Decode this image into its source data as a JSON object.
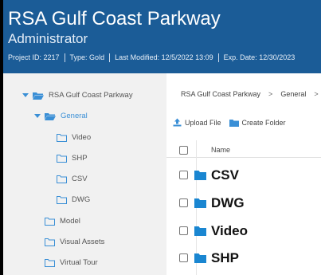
{
  "header": {
    "title": "RSA Gulf Coast Parkway",
    "role": "Administrator",
    "meta": {
      "project_id": "Project ID: 2217",
      "type": "Type: Gold",
      "last_modified": "Last Modified: 12/5/2022 13:09",
      "exp_date": "Exp. Date: 12/30/2023"
    }
  },
  "sidebar": {
    "root": "RSA Gulf Coast Parkway",
    "general": "General",
    "general_children": [
      "Video",
      "SHP",
      "CSV",
      "DWG"
    ],
    "others": [
      "Model",
      "Visual Assets",
      "Virtual Tour"
    ]
  },
  "main": {
    "breadcrumb": [
      "RSA Gulf Coast Parkway",
      "General"
    ],
    "toolbar": {
      "upload": "Upload File",
      "create_folder": "Create Folder"
    },
    "table": {
      "name_header": "Name",
      "rows": [
        "CSV",
        "DWG",
        "Video",
        "SHP"
      ]
    }
  },
  "colors": {
    "header_bg": "#1b5c97",
    "accent": "#3a8fd6",
    "sidebar_bg": "#f1f1f1"
  }
}
